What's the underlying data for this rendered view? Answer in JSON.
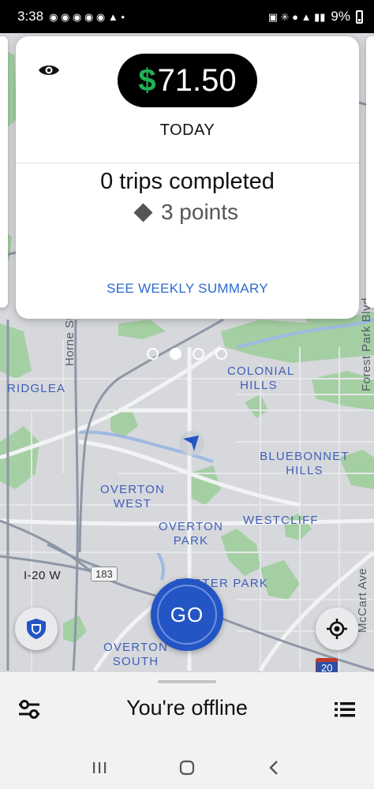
{
  "status_bar": {
    "time": "3:38",
    "battery": "9%"
  },
  "card": {
    "earnings_symbol": "$",
    "earnings_amount": "71.50",
    "period": "TODAY",
    "trips_count": "0",
    "trips_text": "trips completed",
    "points_text": "3 points",
    "weekly_link": "SEE WEEKLY SUMMARY"
  },
  "pagination": {
    "total": 4,
    "active_index": 1
  },
  "map": {
    "labels": {
      "ridglea": "RIDGLEA",
      "colonial_hills_1": "COLONIAL",
      "colonial_hills_2": "HILLS",
      "bluebonnet_1": "BLUEBONNET",
      "bluebonnet_2": "HILLS",
      "overton_west_1": "OVERTON",
      "overton_west_2": "WEST",
      "overton_park_1": "OVERTON",
      "overton_park_2": "PARK",
      "westcliff": "WESTCLIFF",
      "foster_park": "FOSTER PARK",
      "overton_south_1": "OVERTON",
      "overton_south_2": "SOUTH",
      "horne_st": "Horne St",
      "forest_park_blvd": "Forest Park Blvd",
      "mccart_ave": "McCart Ave",
      "i20w": "I-20 W",
      "hwy_183": "183",
      "hwy_20": "20"
    }
  },
  "go_button": {
    "label": "GO"
  },
  "bottom_sheet": {
    "status": "You're offline"
  },
  "colors": {
    "primary_blue": "#2455c5",
    "earnings_green": "#1fb155",
    "link_blue": "#2c6ad2"
  },
  "icons": {
    "eye": "eye-icon",
    "shield": "shield-icon",
    "locate": "crosshair-icon",
    "filters": "sliders-icon",
    "list": "list-icon",
    "location": "navigation-arrow-icon"
  }
}
